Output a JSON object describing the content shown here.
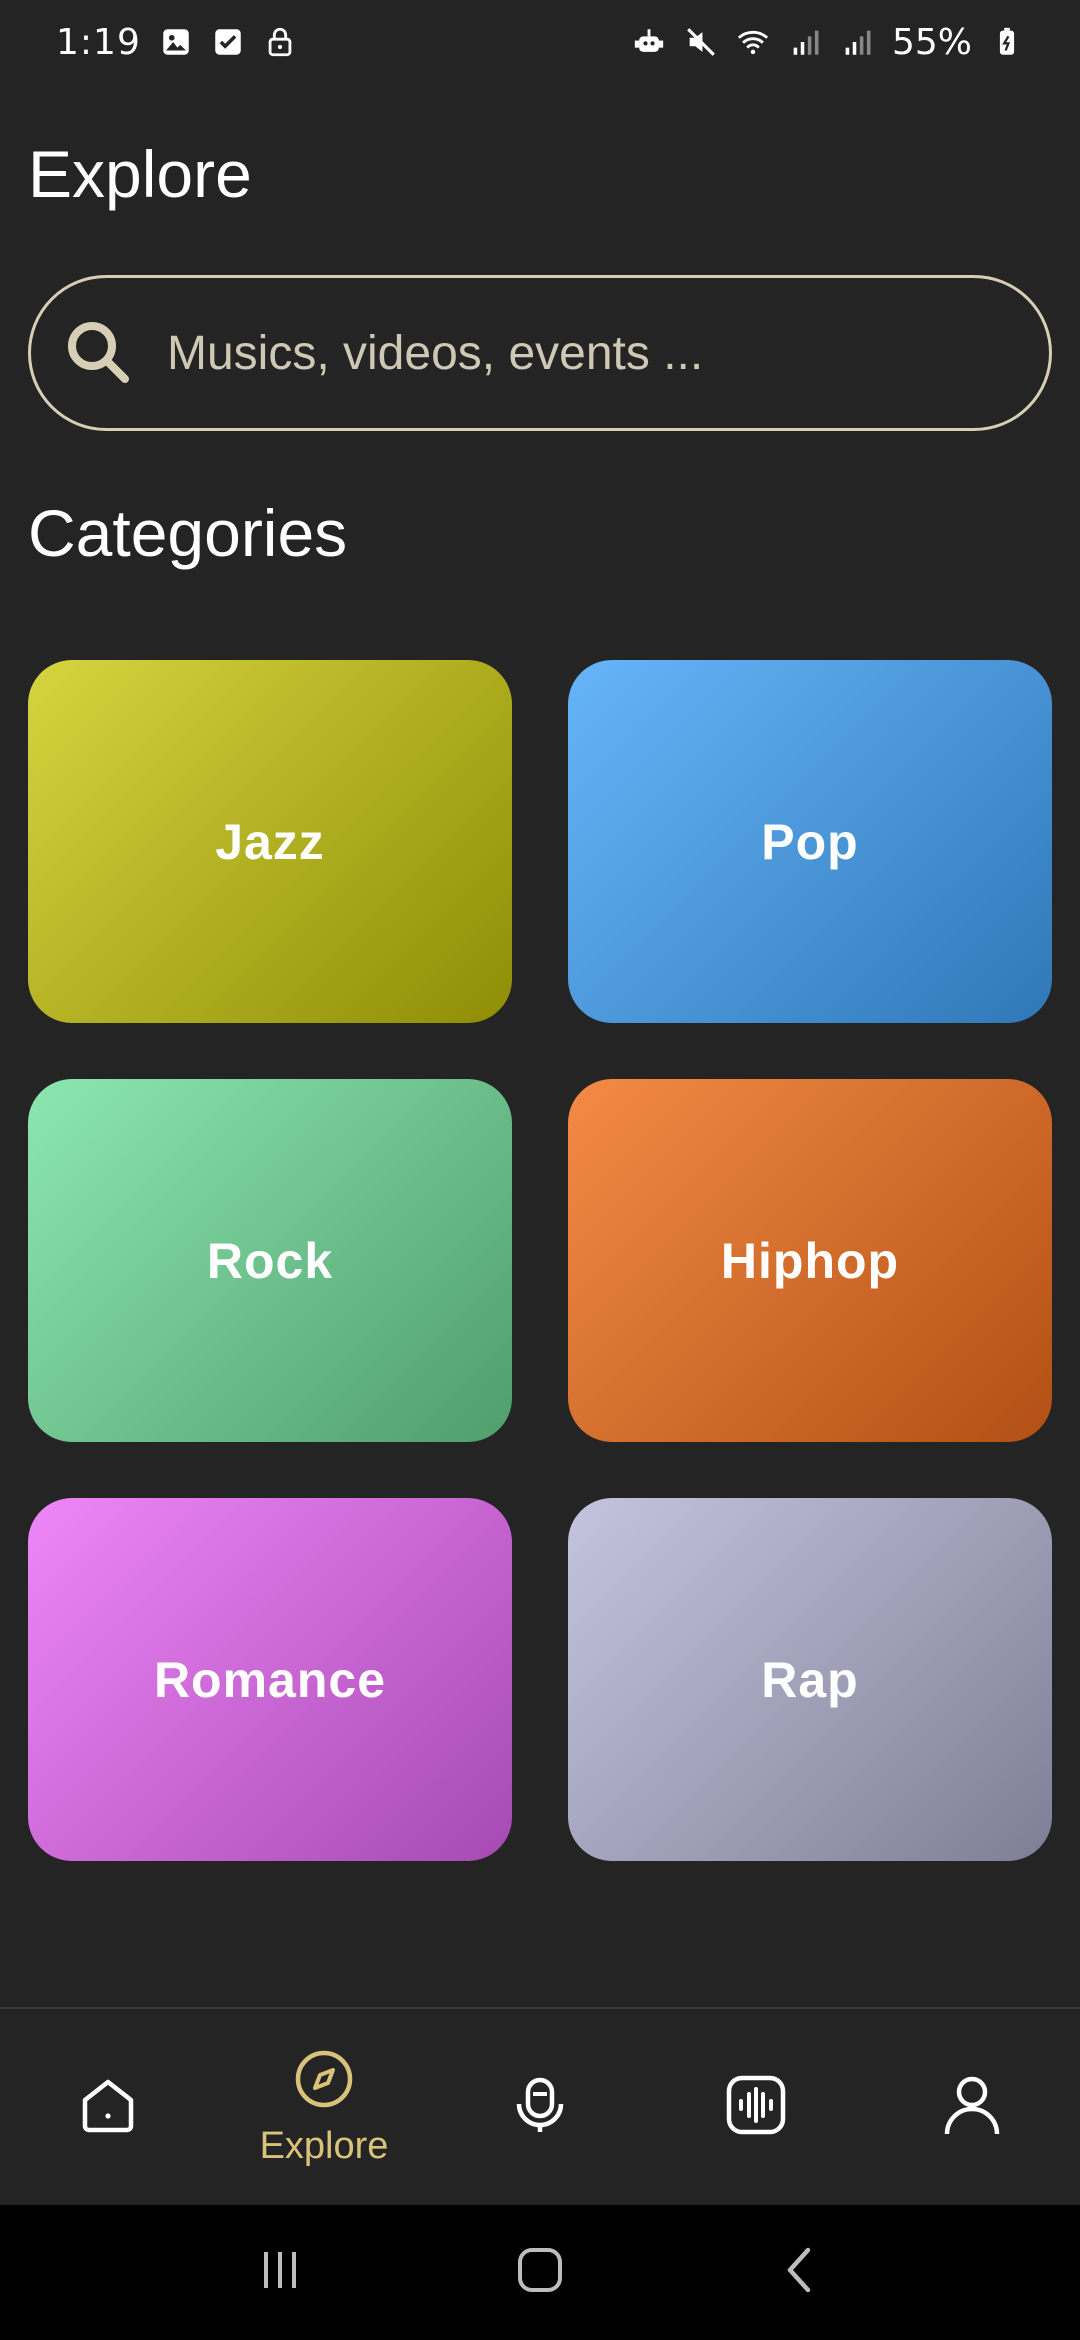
{
  "status_bar": {
    "time": "1:19",
    "battery": "55%",
    "left_icons": [
      "image-icon",
      "checkbox-icon",
      "lock-icon"
    ],
    "right_icons": [
      "robot-icon",
      "mute-icon",
      "wifi-icon",
      "signal-icon",
      "signal-icon-2",
      "battery-icon"
    ]
  },
  "header": {
    "title": "Explore"
  },
  "search": {
    "placeholder": "Musics, videos, events ...",
    "value": ""
  },
  "categories_section": {
    "title": "Categories",
    "items": [
      {
        "label": "Jazz",
        "color_start": "#d6d43f",
        "color_end": "#8e8d05"
      },
      {
        "label": "Pop",
        "color_start": "#66b5f8",
        "color_end": "#2f78b8"
      },
      {
        "label": "Rock",
        "color_start": "#8de6b0",
        "color_end": "#4f9e6c"
      },
      {
        "label": "Hiphop",
        "color_start": "#f38b45",
        "color_end": "#b24f14"
      },
      {
        "label": "Romance",
        "color_start": "#ee86f8",
        "color_end": "#a64ab3"
      },
      {
        "label": "Rap",
        "color_start": "#c4c4de",
        "color_end": "#7e7e96"
      }
    ]
  },
  "bottom_nav": {
    "active_color": "#d9c27a",
    "items": [
      {
        "icon": "home-icon",
        "label": ""
      },
      {
        "icon": "compass-icon",
        "label": "Explore",
        "active": true
      },
      {
        "icon": "microphone-icon",
        "label": ""
      },
      {
        "icon": "audio-wave-icon",
        "label": ""
      },
      {
        "icon": "user-icon",
        "label": ""
      }
    ]
  },
  "system_nav": {
    "buttons": [
      "recents-icon",
      "home-button-icon",
      "back-icon"
    ]
  }
}
